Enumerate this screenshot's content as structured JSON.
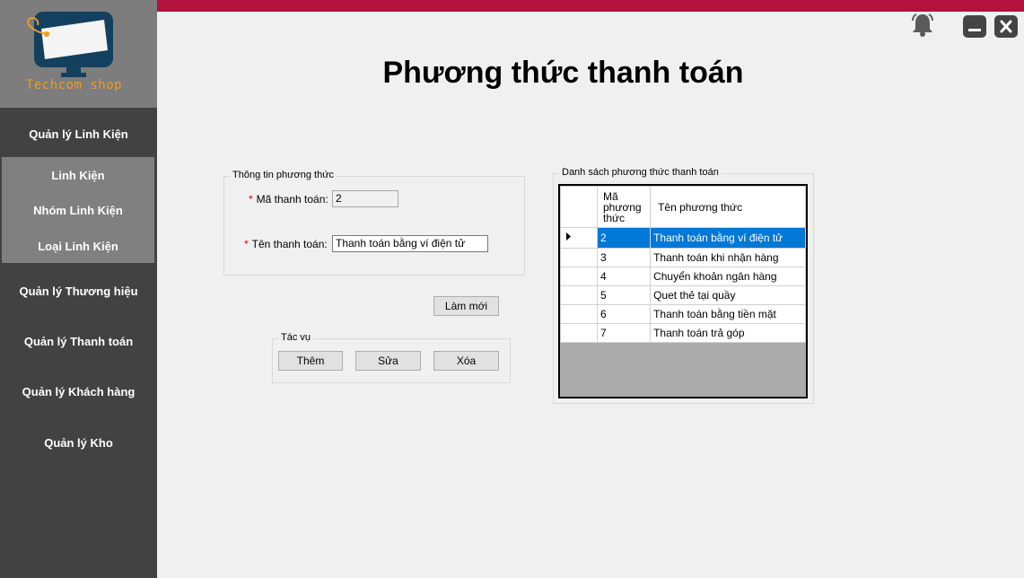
{
  "logo": {
    "text": "Techcom shop"
  },
  "sidebar": {
    "group_title": "Quản lý Linh Kiện",
    "sub_items": [
      "Linh Kiện",
      "Nhóm Linh Kiện",
      "Loại Linh Kiện"
    ],
    "items": [
      "Quản lý Thương hiệu",
      "Quản lý Thanh toán",
      "Quản lý Khách hàng",
      "Quản lý Kho"
    ]
  },
  "page": {
    "title": "Phương thức thanh toán"
  },
  "icons": {
    "bell": "bell-icon",
    "minimize": "minimize-icon",
    "close": "close-icon"
  },
  "colors": {
    "topbar": "#b3123b",
    "sidebar": "#424242",
    "selection": "#0078d7",
    "logo_text": "#f29a1f"
  },
  "info_group": {
    "title": "Thông tin phương thức",
    "required_mark": "*",
    "ma_label": "Mã thanh toán:",
    "ma_value": "2",
    "ten_label": "Tên thanh toán:",
    "ten_value": "Thanh toán bằng ví điện tử"
  },
  "buttons": {
    "refresh": "Làm mới",
    "add": "Thêm",
    "edit": "Sửa",
    "delete": "Xóa"
  },
  "actions_group": {
    "title": "Tác vụ"
  },
  "list_group": {
    "title": "Danh sách phương thức thanh toán",
    "columns": [
      "Mã phương thức",
      "Tên phương thức"
    ],
    "rows": [
      {
        "id": "2",
        "name": "Thanh toán bằng ví điện tử"
      },
      {
        "id": "3",
        "name": "Thanh toán khi nhận hàng"
      },
      {
        "id": "4",
        "name": "Chuyển khoản ngân hàng"
      },
      {
        "id": "5",
        "name": "Quet thẻ tại quầy"
      },
      {
        "id": "6",
        "name": "Thanh toán bằng tiền mặt"
      },
      {
        "id": "7",
        "name": "Thanh toán trả góp"
      }
    ]
  }
}
